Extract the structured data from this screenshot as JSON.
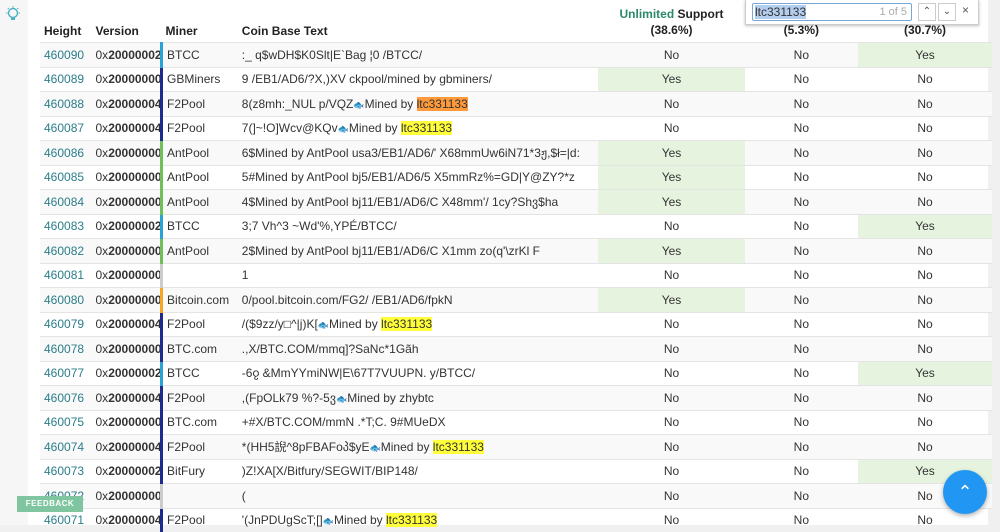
{
  "headers": {
    "height": "Height",
    "version": "Version",
    "miner": "Miner",
    "coinbase": "Coin Base Text",
    "col1_accent": "Unlimited",
    "col1_rest": " Support",
    "col1_pct": "(38.6%)",
    "col2_pct": "(5.3%)",
    "col3_pct": "(30.7%)"
  },
  "find": {
    "query": "ltc331133",
    "count": "1 of 5",
    "prev": "⌃",
    "next": "⌄",
    "close": "×"
  },
  "feedback": "FEEDBACK",
  "scroll_top": "⌃",
  "rows": [
    {
      "height": "460090",
      "vp": "0x",
      "vb": "20000002",
      "miner": "BTCC",
      "mc": "#29a3d6",
      "pre": ":_ q$wDH$K0Slt|E`Bag ¦0 /BTCC/",
      "mid": "",
      "hl": "",
      "post": "",
      "c1": "No",
      "c2": "No",
      "c3": "Yes"
    },
    {
      "height": "460089",
      "vp": "0x",
      "vb": "20000000",
      "miner": "GBMiners",
      "mc": "#1f2b8c",
      "pre": "9 /EB1/AD6/?X,)XV ckpool/mined by gbminers/",
      "mid": "",
      "hl": "",
      "post": "",
      "c1": "Yes",
      "c2": "No",
      "c3": "No"
    },
    {
      "height": "460088",
      "vp": "0x",
      "vb": "20000004",
      "miner": "F2Pool",
      "mc": "#1f2b8c",
      "pre": "8(z8mh:_NUL p/VQZ",
      "mid": "Mined by ",
      "hl": "ltc331133",
      "cur": true,
      "post": "",
      "c1": "No",
      "c2": "No",
      "c3": "No"
    },
    {
      "height": "460087",
      "vp": "0x",
      "vb": "20000004",
      "miner": "F2Pool",
      "mc": "#1f2b8c",
      "pre": "7(]~!O]Wcv@KQv",
      "mid": "Mined by ",
      "hl": "ltc331133",
      "post": "",
      "c1": "No",
      "c2": "No",
      "c3": "No"
    },
    {
      "height": "460086",
      "vp": "0x",
      "vb": "20000000",
      "miner": "AntPool",
      "mc": "#6fbf5c",
      "pre": "6$Mined by AntPool usa3/EB1/AD6/' X68mmUw6iN71*3ჟ,$ł=|d:",
      "mid": "",
      "hl": "",
      "post": "",
      "c1": "Yes",
      "c2": "No",
      "c3": "No"
    },
    {
      "height": "460085",
      "vp": "0x",
      "vb": "20000000",
      "miner": "AntPool",
      "mc": "#6fbf5c",
      "pre": "5#Mined by AntPool bj5/EB1/AD6/5 X5mmRz%=GD|Y@ZY?*z",
      "mid": "",
      "hl": "",
      "post": "",
      "c1": "Yes",
      "c2": "No",
      "c3": "No"
    },
    {
      "height": "460084",
      "vp": "0x",
      "vb": "20000000",
      "miner": "AntPool",
      "mc": "#6fbf5c",
      "pre": "4$Mined by AntPool bj11/EB1/AD6/C X48mm'/ 1cy?Shვ$ha",
      "mid": "",
      "hl": "",
      "post": "",
      "c1": "Yes",
      "c2": "No",
      "c3": "No"
    },
    {
      "height": "460083",
      "vp": "0x",
      "vb": "20000002",
      "miner": "BTCC",
      "mc": "#29a3d6",
      "pre": "3;7 Vh^3 ~Wd'%,YPÉ/BTCC/",
      "mid": "",
      "hl": "",
      "post": "",
      "c1": "No",
      "c2": "No",
      "c3": "Yes"
    },
    {
      "height": "460082",
      "vp": "0x",
      "vb": "20000000",
      "miner": "AntPool",
      "mc": "#6fbf5c",
      "pre": "2$Mined by AntPool bj11/EB1/AD6/C X1mm zo(q'\\zrKl F",
      "mid": "",
      "hl": "",
      "post": "",
      "c1": "Yes",
      "c2": "No",
      "c3": "No"
    },
    {
      "height": "460081",
      "vp": "0x",
      "vb": "20000000",
      "miner": "",
      "mc": "#cccccc",
      "pre": "1",
      "mid": "",
      "hl": "",
      "post": "",
      "c1": "No",
      "c2": "No",
      "c3": "No"
    },
    {
      "height": "460080",
      "vp": "0x",
      "vb": "20000000",
      "miner": "Bitcoin.com",
      "mc": "#f5a623",
      "pre": "0/pool.bitcoin.com/FG2/ /EB1/AD6/fpkN",
      "mid": "",
      "hl": "",
      "post": "",
      "c1": "Yes",
      "c2": "No",
      "c3": "No"
    },
    {
      "height": "460079",
      "vp": "0x",
      "vb": "20000004",
      "miner": "F2Pool",
      "mc": "#1f2b8c",
      "pre": "/($9zz/y□^|j)K[",
      "mid": "Mined by ",
      "hl": "ltc331133",
      "post": "",
      "c1": "No",
      "c2": "No",
      "c3": "No"
    },
    {
      "height": "460078",
      "vp": "0x",
      "vb": "20000000",
      "miner": "BTC.com",
      "mc": "#1f2b8c",
      "pre": ".,X/BTC.COM/mmq]?SaNc*1Gãh",
      "mid": "",
      "hl": "",
      "post": "",
      "c1": "No",
      "c2": "No",
      "c3": "No"
    },
    {
      "height": "460077",
      "vp": "0x",
      "vb": "20000002",
      "miner": "BTCC",
      "mc": "#29a3d6",
      "pre": "-6ჹ &MmYYmiNW|E\\67T7VUUPN. y/BTCC/",
      "mid": "",
      "hl": "",
      "post": "",
      "c1": "No",
      "c2": "No",
      "c3": "Yes"
    },
    {
      "height": "460076",
      "vp": "0x",
      "vb": "20000004",
      "miner": "F2Pool",
      "mc": "#1f2b8c",
      "pre": ",(FpOLk79 %?-5ვ",
      "mid": "Mined by zhybtc",
      "hl": "",
      "post": "",
      "c1": "No",
      "c2": "No",
      "c3": "No"
    },
    {
      "height": "460075",
      "vp": "0x",
      "vb": "20000000",
      "miner": "BTC.com",
      "mc": "#1f2b8c",
      "pre": "+#X/BTC.COM/mmN .*T;C. 9#MUeDX",
      "mid": "",
      "hl": "",
      "post": "",
      "c1": "No",
      "c2": "No",
      "c3": "No"
    },
    {
      "height": "460074",
      "vp": "0x",
      "vb": "20000004",
      "miner": "F2Pool",
      "mc": "#1f2b8c",
      "pre": "*(HH5誽^8pFBAFoპ$yE",
      "mid": "Mined by ",
      "hl": "ltc331133",
      "post": "",
      "c1": "No",
      "c2": "No",
      "c3": "No"
    },
    {
      "height": "460073",
      "vp": "0x",
      "vb": "20000002",
      "miner": "BitFury",
      "mc": "#1f2b8c",
      "pre": ")Z!XA[X/Bitfury/SEGWIT/BIP148/",
      "mid": "",
      "hl": "",
      "post": "",
      "c1": "No",
      "c2": "No",
      "c3": "Yes"
    },
    {
      "height": "460072",
      "vp": "0x",
      "vb": "20000000",
      "miner": "",
      "mc": "#cccccc",
      "pre": "(",
      "mid": "",
      "hl": "",
      "post": "",
      "c1": "No",
      "c2": "No",
      "c3": "No"
    },
    {
      "height": "460071",
      "vp": "0x",
      "vb": "20000004",
      "miner": "F2Pool",
      "mc": "#1f2b8c",
      "pre": "'(JnPDUgScT;[]",
      "mid": "Mined by ",
      "hl": "ltc331133",
      "post": "",
      "c1": "No",
      "c2": "No",
      "c3": "No"
    }
  ]
}
